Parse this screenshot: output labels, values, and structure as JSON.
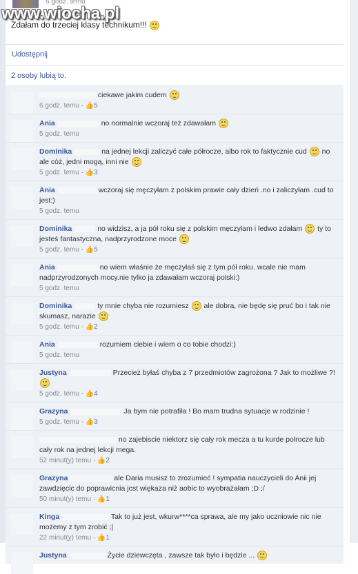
{
  "watermark": "www.wiocha.pl",
  "post": {
    "time": "6 godz. temu",
    "status": "Zdałam do trzeciej klasy technikum!!!",
    "share_label": "Udostępnij",
    "likes_text": "2 osoby lubią to."
  },
  "comments": [
    {
      "author": "",
      "text": "ciekawe jakim cudem",
      "emoticon": true,
      "time": "6 godz. temu",
      "likes": "5",
      "mask_w": 82
    },
    {
      "author": "Ania",
      "text": "no normalnie wczoraj też zdawałam",
      "emoticon": true,
      "time": "5 godz. temu",
      "likes": "",
      "mask_w": 60
    },
    {
      "author": "Dominika",
      "text": "na jednej lekcji zaliczyć całe półrocze, albo rok to faktycznie cud",
      "emoticon": true,
      "text2": "no ale cóż, jedni mogą, inni nie",
      "emoticon2": true,
      "time": "5 godz. temu",
      "likes": "3",
      "mask_w": 36
    },
    {
      "author": "Ania",
      "text": "wczoraj się męczyłam z polskim prawie cały dzień .no i zaliczyłam .cud to jest:)",
      "time": "5 godz. temu",
      "likes": "",
      "mask_w": 56
    },
    {
      "author": "Dominika",
      "text": "no widzisz, a ja pół roku się z polskim męczyłam i ledwo zdałam",
      "emoticon": true,
      "text2": "ty to jesteś fantastyczna, nadprzyrodzone moce",
      "emoticon2": true,
      "time": "5 godz. temu",
      "likes": "5",
      "mask_w": 30
    },
    {
      "author": "Ania",
      "text": "no wiem właśnie że męczyłaś się z tym pół roku. wcale nie mam nadprzyrodzonych mocy.nie tylko ja zdawałam wczoraj polski:)",
      "time": "5 godz. temu",
      "likes": "",
      "mask_w": 58
    },
    {
      "author": "Dominika",
      "text": "ty mnie chyba nie rozumiesz",
      "emoticon": true,
      "text2": "ale dobra, nie będę się pruć bo i tak nie skumasz, narazie",
      "emoticon2": true,
      "time": "5 godz. temu",
      "likes": "2",
      "mask_w": 30
    },
    {
      "author": "Ania",
      "text": "rozumiem ciebie i wiem o co tobie chodzi:)",
      "time": "5 godz. temu",
      "likes": "",
      "mask_w": 58
    },
    {
      "author": "Justyna",
      "text": "Przecież byłaś chyba z 7 przedmiotów zagrożona ? Jak to możliwe ?!",
      "emoticon": true,
      "time": "5 godz. temu",
      "likes": "4",
      "mask_w": 60
    },
    {
      "author": "Grazyna",
      "text": "Ja bym nie potrafiła ! Bo mam trudna sytuacje w rodzinie !",
      "time": "5 godz. temu",
      "likes": "3",
      "mask_w": 74
    },
    {
      "author": "",
      "text": "no zajebiscie niektorz się cały rok mecza a tu kurde polrocze lub cały rok na jednej lekcji mega.",
      "time": "52 minut(y) temu",
      "likes": "2",
      "mask_w": 112
    },
    {
      "author": "Grazyna",
      "text": "ale Daria musisz to zrozumieć ! sympatia nauczycieli do Anii jej zawdzięcic do poprawicnia jcst więkaza niż aobic to wyobrażałam ;D ;/",
      "time": "50 minut(y) temu",
      "likes": "1",
      "mask_w": 60
    },
    {
      "author": "Kinga",
      "text": "Tak to już jest, wkurw****ca sprawa, ale my jako uczniowie nic nie możemy z tym zrobić ;|",
      "time": "22 minut(y) temu",
      "likes": "1",
      "mask_w": 68
    },
    {
      "author": "Justyna",
      "text": "Życie dziewczęta , zawsze tak było i będzie ...",
      "emoticon": true,
      "time": "",
      "likes": "",
      "mask_w": 52
    }
  ]
}
